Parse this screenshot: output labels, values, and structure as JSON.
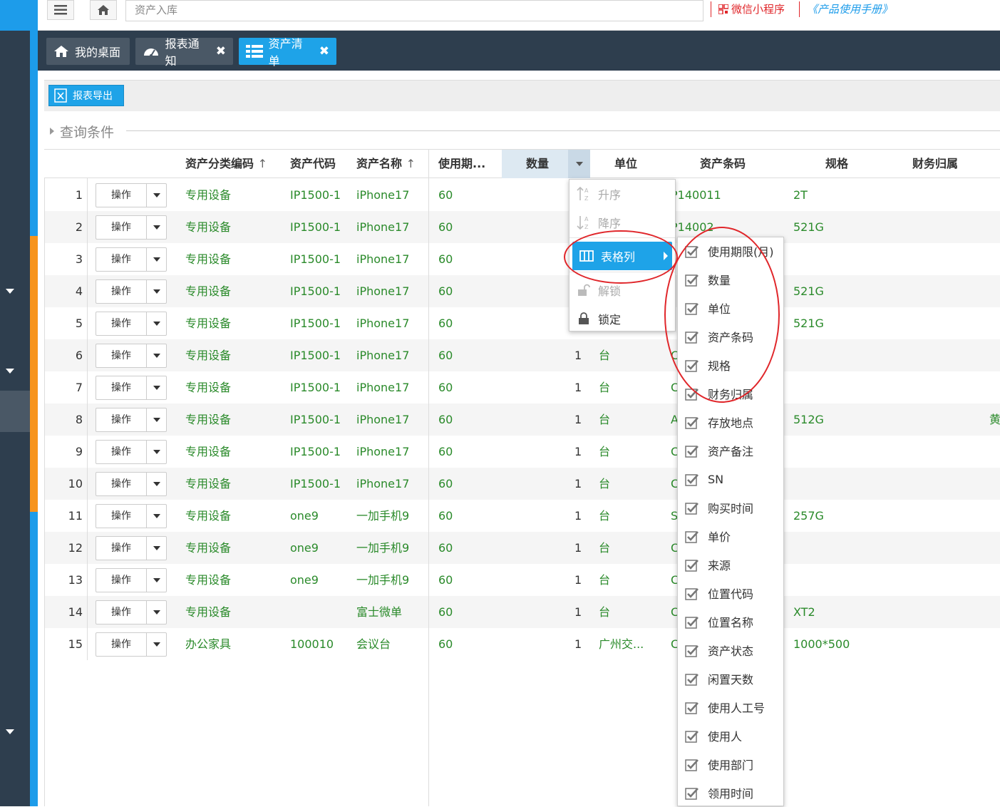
{
  "topbar": {
    "breadcrumb": "资产入库",
    "link_miniprogram": "微信小程序",
    "link_manual": "《产品使用手册》"
  },
  "tabs": [
    {
      "label": "我的桌面",
      "closable": false,
      "active": false
    },
    {
      "label": "报表通知",
      "closable": true,
      "active": false
    },
    {
      "label": "资产清单",
      "closable": true,
      "active": true
    }
  ],
  "toolbar": {
    "export_label": "报表导出"
  },
  "query": {
    "label": "查询条件"
  },
  "table": {
    "headers": {
      "category": "资产分类编码",
      "code": "资产代码",
      "name": "资产名称",
      "period": "使用期...",
      "qty": "数量",
      "unit": "单位",
      "barcode": "资产条码",
      "spec": "规格",
      "finance": "财务归属"
    },
    "op_label": "操作",
    "rows": [
      {
        "idx": "1",
        "category": "专用设备",
        "code": "IP1500-1",
        "name": "iPhone17",
        "period": "60",
        "qty": "",
        "unit": "",
        "barcode": "P140011",
        "spec": "2T",
        "extra": ""
      },
      {
        "idx": "2",
        "category": "专用设备",
        "code": "IP1500-1",
        "name": "iPhone17",
        "period": "60",
        "qty": "",
        "unit": "",
        "barcode": "P14002",
        "spec": "521G",
        "extra": ""
      },
      {
        "idx": "3",
        "category": "专用设备",
        "code": "IP1500-1",
        "name": "iPhone17",
        "period": "60",
        "qty": "",
        "unit": "",
        "barcode": "",
        "spec": "",
        "extra": ""
      },
      {
        "idx": "4",
        "category": "专用设备",
        "code": "IP1500-1",
        "name": "iPhone17",
        "period": "60",
        "qty": "",
        "unit": "",
        "barcode": "",
        "spec": "521G",
        "extra": ""
      },
      {
        "idx": "5",
        "category": "专用设备",
        "code": "IP1500-1",
        "name": "iPhone17",
        "period": "60",
        "qty": "",
        "unit": "",
        "barcode": "",
        "spec": "521G",
        "extra": ""
      },
      {
        "idx": "6",
        "category": "专用设备",
        "code": "IP1500-1",
        "name": "iPhone17",
        "period": "60",
        "qty": "1",
        "unit": "台",
        "barcode": "C",
        "spec": "",
        "extra": ""
      },
      {
        "idx": "7",
        "category": "专用设备",
        "code": "IP1500-1",
        "name": "iPhone17",
        "period": "60",
        "qty": "1",
        "unit": "台",
        "barcode": "C",
        "spec": "",
        "extra": ""
      },
      {
        "idx": "8",
        "category": "专用设备",
        "code": "IP1500-1",
        "name": "iPhone17",
        "period": "60",
        "qty": "1",
        "unit": "台",
        "barcode": "A",
        "spec": "512G",
        "extra": "黄"
      },
      {
        "idx": "9",
        "category": "专用设备",
        "code": "IP1500-1",
        "name": "iPhone17",
        "period": "60",
        "qty": "1",
        "unit": "台",
        "barcode": "C",
        "spec": "",
        "extra": ""
      },
      {
        "idx": "10",
        "category": "专用设备",
        "code": "IP1500-1",
        "name": "iPhone17",
        "period": "60",
        "qty": "1",
        "unit": "台",
        "barcode": "C",
        "spec": "",
        "extra": ""
      },
      {
        "idx": "11",
        "category": "专用设备",
        "code": "one9",
        "name": "一加手机9",
        "period": "60",
        "qty": "1",
        "unit": "台",
        "barcode": "S",
        "spec": "257G",
        "extra": ""
      },
      {
        "idx": "12",
        "category": "专用设备",
        "code": "one9",
        "name": "一加手机9",
        "period": "60",
        "qty": "1",
        "unit": "台",
        "barcode": "C",
        "spec": "",
        "extra": ""
      },
      {
        "idx": "13",
        "category": "专用设备",
        "code": "one9",
        "name": "一加手机9",
        "period": "60",
        "qty": "1",
        "unit": "台",
        "barcode": "C",
        "spec": "",
        "extra": ""
      },
      {
        "idx": "14",
        "category": "专用设备",
        "code": "",
        "name": "富士微单",
        "period": "60",
        "qty": "1",
        "unit": "台",
        "barcode": "C",
        "spec": "XT2",
        "extra": ""
      },
      {
        "idx": "15",
        "category": "办公家具",
        "code": "100010",
        "name": "会议台",
        "period": "60",
        "qty": "1",
        "unit": "广州交...",
        "barcode": "C",
        "spec": "1000*500",
        "extra": ""
      }
    ]
  },
  "column_menu": {
    "items": [
      {
        "label": "升序",
        "icon": "sort-asc-icon",
        "disabled": true
      },
      {
        "label": "降序",
        "icon": "sort-desc-icon",
        "disabled": true
      },
      {
        "label": "表格列",
        "icon": "columns-icon",
        "disabled": false,
        "highlighted": true
      },
      {
        "label": "解锁",
        "icon": "unlock-icon",
        "disabled": true
      },
      {
        "label": "锁定",
        "icon": "lock-icon",
        "disabled": false
      }
    ],
    "columns": [
      "使用期限(月)",
      "数量",
      "单位",
      "资产条码",
      "规格",
      "财务归属",
      "存放地点",
      "资产备注",
      "SN",
      "购买时间",
      "单价",
      "来源",
      "位置代码",
      "位置名称",
      "资产状态",
      "闲置天数",
      "使用人工号",
      "使用人",
      "使用部门",
      "领用时间"
    ]
  },
  "colors": {
    "accent": "#1ea3e8",
    "nav_dark": "#2e3e4e",
    "green_text": "#2a8a2a",
    "red_link": "#e0262a",
    "highlight_circle": "#e0262a",
    "stripe_orange": "#f7941d"
  }
}
